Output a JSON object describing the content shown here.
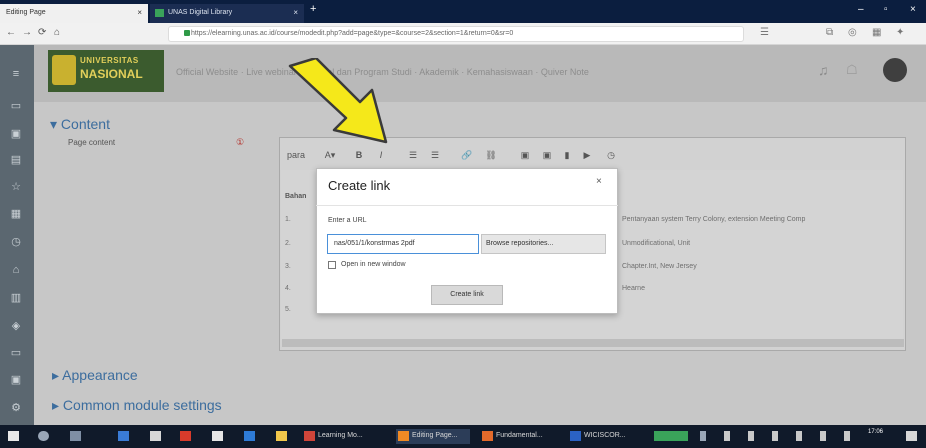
{
  "browser": {
    "tabs": [
      {
        "label": "Editing Page",
        "close": "×"
      },
      {
        "label": "UNAS Digital Library",
        "close": "×"
      }
    ],
    "new_tab": "+",
    "window_controls": {
      "minimize": "–",
      "maximize": "▫",
      "close": "×"
    },
    "address": "https://elearning.unas.ac.id/course/modedit.php?add=page&type=&course=2&section=1&return=0&sr=0",
    "nav": {
      "back": "←",
      "forward": "→",
      "reload": "⟳",
      "home": "⌂"
    }
  },
  "site": {
    "logo_line1": "UNIVERSITAS",
    "logo_line2": "NASIONAL",
    "nav_links": "Official Website · Live webinar · Tutorial dan Program Studi · Akademik · Kemahasiswaan · Quiver Note"
  },
  "form": {
    "content_header": "Content",
    "page_content_label": "Page content",
    "required_icon": "①",
    "editor_heading": "Bahan",
    "editor_lines": [
      "Pentanyaan system Terry Colony, extension Meeting Comp",
      "Unmodificational, Unit",
      "Chapter.Int, New Jersey",
      "Hearne"
    ],
    "editor_numbers": [
      "1.",
      "2.",
      "3.",
      "4.",
      "5."
    ],
    "toolbar_icons": [
      "para",
      "A▾",
      "B",
      "I",
      "☰",
      "☰",
      "🔗",
      "⛓",
      "▣",
      "▣",
      "▮",
      "▶",
      "◷"
    ],
    "appearance_header": "Appearance",
    "common_header": "Common module settings"
  },
  "dialog": {
    "title": "Create link",
    "close": "×",
    "url_label": "Enter a URL",
    "url_value": "nas/051/1/konstrmas 2pdf",
    "browse_button": "Browse repositories...",
    "new_window_label": "Open in new window",
    "create_button": "Create link"
  },
  "taskbar": {
    "items": [
      "Learning Mo...",
      "Editing Page...",
      "Fundamental...",
      "WICISCOR..."
    ],
    "clock": "17:06"
  },
  "colors": {
    "accent": "#3c6d9e",
    "arrow": "#f5e81a"
  }
}
